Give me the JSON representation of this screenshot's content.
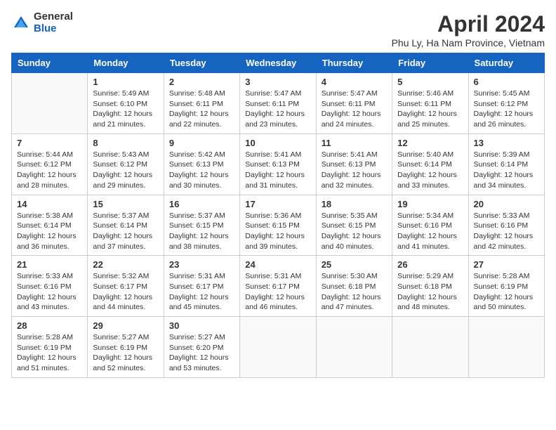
{
  "logo": {
    "general": "General",
    "blue": "Blue"
  },
  "title": "April 2024",
  "subtitle": "Phu Ly, Ha Nam Province, Vietnam",
  "days_of_week": [
    "Sunday",
    "Monday",
    "Tuesday",
    "Wednesday",
    "Thursday",
    "Friday",
    "Saturday"
  ],
  "weeks": [
    [
      {
        "day": "",
        "text": ""
      },
      {
        "day": "1",
        "text": "Sunrise: 5:49 AM\nSunset: 6:10 PM\nDaylight: 12 hours\nand 21 minutes."
      },
      {
        "day": "2",
        "text": "Sunrise: 5:48 AM\nSunset: 6:11 PM\nDaylight: 12 hours\nand 22 minutes."
      },
      {
        "day": "3",
        "text": "Sunrise: 5:47 AM\nSunset: 6:11 PM\nDaylight: 12 hours\nand 23 minutes."
      },
      {
        "day": "4",
        "text": "Sunrise: 5:47 AM\nSunset: 6:11 PM\nDaylight: 12 hours\nand 24 minutes."
      },
      {
        "day": "5",
        "text": "Sunrise: 5:46 AM\nSunset: 6:11 PM\nDaylight: 12 hours\nand 25 minutes."
      },
      {
        "day": "6",
        "text": "Sunrise: 5:45 AM\nSunset: 6:12 PM\nDaylight: 12 hours\nand 26 minutes."
      }
    ],
    [
      {
        "day": "7",
        "text": "Sunrise: 5:44 AM\nSunset: 6:12 PM\nDaylight: 12 hours\nand 28 minutes."
      },
      {
        "day": "8",
        "text": "Sunrise: 5:43 AM\nSunset: 6:12 PM\nDaylight: 12 hours\nand 29 minutes."
      },
      {
        "day": "9",
        "text": "Sunrise: 5:42 AM\nSunset: 6:13 PM\nDaylight: 12 hours\nand 30 minutes."
      },
      {
        "day": "10",
        "text": "Sunrise: 5:41 AM\nSunset: 6:13 PM\nDaylight: 12 hours\nand 31 minutes."
      },
      {
        "day": "11",
        "text": "Sunrise: 5:41 AM\nSunset: 6:13 PM\nDaylight: 12 hours\nand 32 minutes."
      },
      {
        "day": "12",
        "text": "Sunrise: 5:40 AM\nSunset: 6:14 PM\nDaylight: 12 hours\nand 33 minutes."
      },
      {
        "day": "13",
        "text": "Sunrise: 5:39 AM\nSunset: 6:14 PM\nDaylight: 12 hours\nand 34 minutes."
      }
    ],
    [
      {
        "day": "14",
        "text": "Sunrise: 5:38 AM\nSunset: 6:14 PM\nDaylight: 12 hours\nand 36 minutes."
      },
      {
        "day": "15",
        "text": "Sunrise: 5:37 AM\nSunset: 6:14 PM\nDaylight: 12 hours\nand 37 minutes."
      },
      {
        "day": "16",
        "text": "Sunrise: 5:37 AM\nSunset: 6:15 PM\nDaylight: 12 hours\nand 38 minutes."
      },
      {
        "day": "17",
        "text": "Sunrise: 5:36 AM\nSunset: 6:15 PM\nDaylight: 12 hours\nand 39 minutes."
      },
      {
        "day": "18",
        "text": "Sunrise: 5:35 AM\nSunset: 6:15 PM\nDaylight: 12 hours\nand 40 minutes."
      },
      {
        "day": "19",
        "text": "Sunrise: 5:34 AM\nSunset: 6:16 PM\nDaylight: 12 hours\nand 41 minutes."
      },
      {
        "day": "20",
        "text": "Sunrise: 5:33 AM\nSunset: 6:16 PM\nDaylight: 12 hours\nand 42 minutes."
      }
    ],
    [
      {
        "day": "21",
        "text": "Sunrise: 5:33 AM\nSunset: 6:16 PM\nDaylight: 12 hours\nand 43 minutes."
      },
      {
        "day": "22",
        "text": "Sunrise: 5:32 AM\nSunset: 6:17 PM\nDaylight: 12 hours\nand 44 minutes."
      },
      {
        "day": "23",
        "text": "Sunrise: 5:31 AM\nSunset: 6:17 PM\nDaylight: 12 hours\nand 45 minutes."
      },
      {
        "day": "24",
        "text": "Sunrise: 5:31 AM\nSunset: 6:17 PM\nDaylight: 12 hours\nand 46 minutes."
      },
      {
        "day": "25",
        "text": "Sunrise: 5:30 AM\nSunset: 6:18 PM\nDaylight: 12 hours\nand 47 minutes."
      },
      {
        "day": "26",
        "text": "Sunrise: 5:29 AM\nSunset: 6:18 PM\nDaylight: 12 hours\nand 48 minutes."
      },
      {
        "day": "27",
        "text": "Sunrise: 5:28 AM\nSunset: 6:19 PM\nDaylight: 12 hours\nand 50 minutes."
      }
    ],
    [
      {
        "day": "28",
        "text": "Sunrise: 5:28 AM\nSunset: 6:19 PM\nDaylight: 12 hours\nand 51 minutes."
      },
      {
        "day": "29",
        "text": "Sunrise: 5:27 AM\nSunset: 6:19 PM\nDaylight: 12 hours\nand 52 minutes."
      },
      {
        "day": "30",
        "text": "Sunrise: 5:27 AM\nSunset: 6:20 PM\nDaylight: 12 hours\nand 53 minutes."
      },
      {
        "day": "",
        "text": ""
      },
      {
        "day": "",
        "text": ""
      },
      {
        "day": "",
        "text": ""
      },
      {
        "day": "",
        "text": ""
      }
    ]
  ]
}
